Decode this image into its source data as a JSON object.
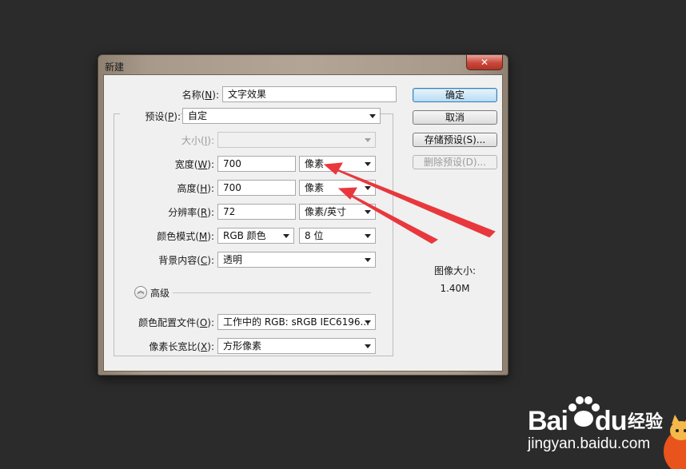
{
  "dialog": {
    "title": "新建",
    "close_label": "✕"
  },
  "form": {
    "name": {
      "label_pre": "名称(",
      "key": "N",
      "label_post": "):",
      "value": "文字效果"
    },
    "preset": {
      "label_pre": "预设(",
      "key": "P",
      "label_post": "):",
      "value": "自定"
    },
    "size": {
      "label_pre": "大小(",
      "key": "I",
      "label_post": "):",
      "value": ""
    },
    "width": {
      "label_pre": "宽度(",
      "key": "W",
      "label_post": "):",
      "value": "700",
      "unit": "像素"
    },
    "height": {
      "label_pre": "高度(",
      "key": "H",
      "label_post": "):",
      "value": "700",
      "unit": "像素"
    },
    "resolution": {
      "label_pre": "分辨率(",
      "key": "R",
      "label_post": "):",
      "value": "72",
      "unit": "像素/英寸"
    },
    "color_mode": {
      "label_pre": "颜色模式(",
      "key": "M",
      "label_post": "):",
      "value": "RGB 颜色",
      "depth": "8 位"
    },
    "background": {
      "label_pre": "背景内容(",
      "key": "C",
      "label_post": "):",
      "value": "透明"
    },
    "advanced": {
      "label": "高级"
    },
    "color_profile": {
      "label_pre": "颜色配置文件(",
      "key": "O",
      "label_post": "):",
      "value": "工作中的 RGB: sRGB IEC6196..."
    },
    "pixel_aspect": {
      "label_pre": "像素长宽比(",
      "key": "X",
      "label_post": "):",
      "value": "方形像素"
    }
  },
  "buttons": {
    "ok": "确定",
    "cancel": "取消",
    "save_preset": "存储预设(S)...",
    "delete_preset": "删除预设(D)..."
  },
  "image_size": {
    "label": "图像大小:",
    "value": "1.40M"
  },
  "annotation": {
    "color": "#e8383d"
  },
  "watermark": {
    "brand_a": "Bai",
    "brand_b": "du",
    "suffix": "经验",
    "url": "jingyan.baidu.com"
  }
}
